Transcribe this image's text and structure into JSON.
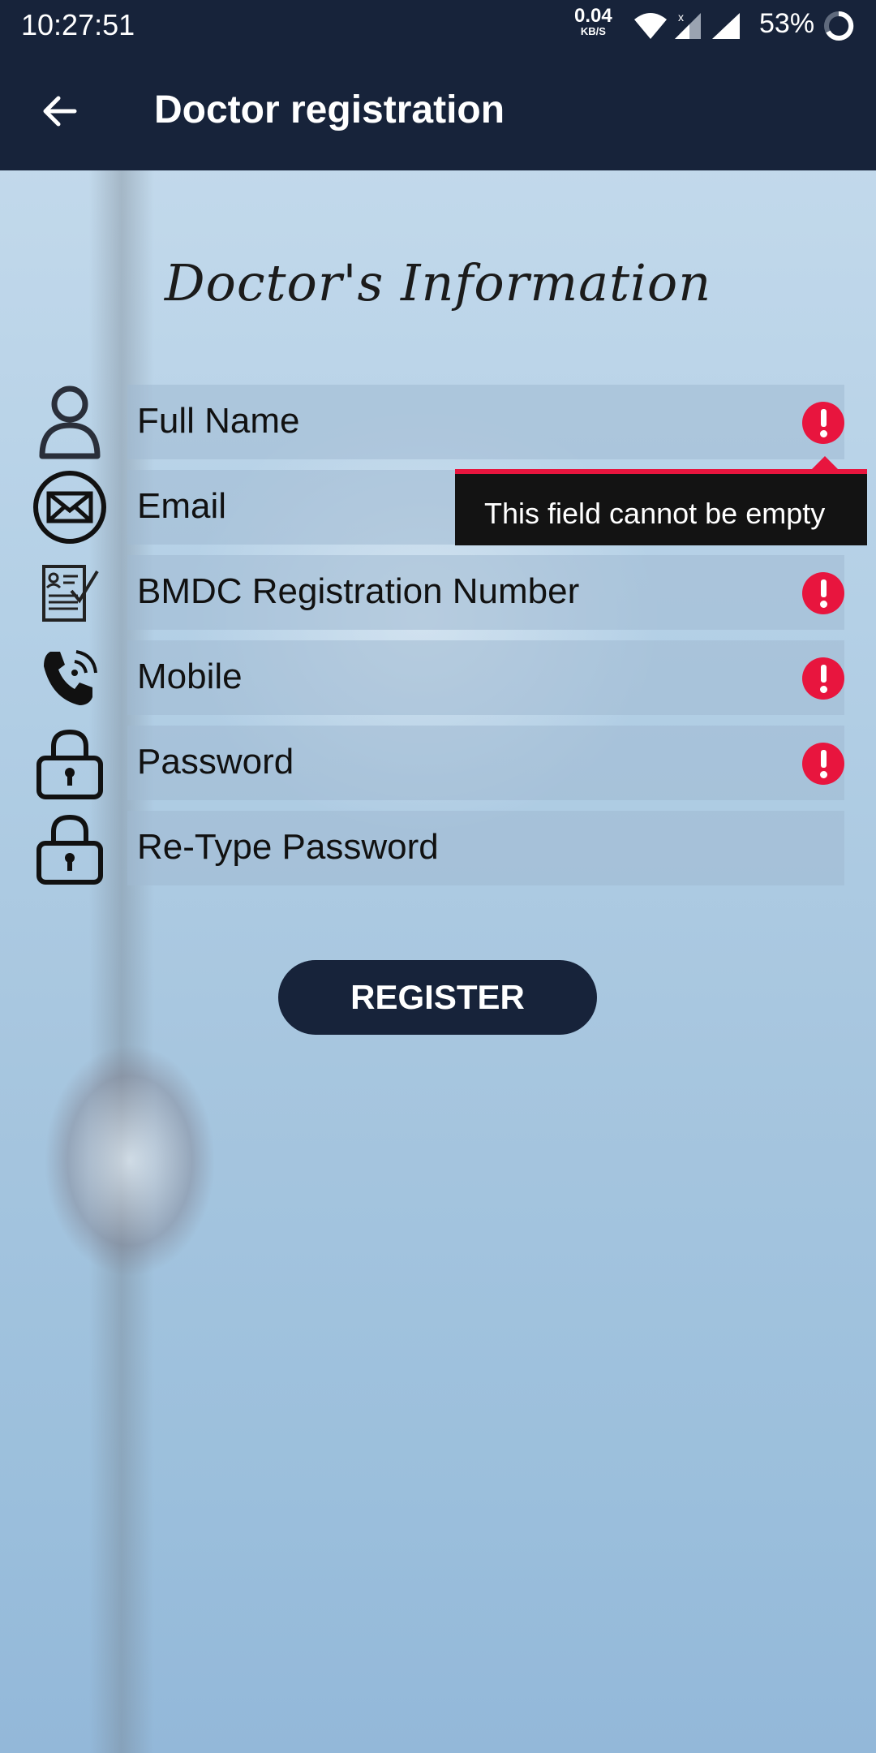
{
  "status_bar": {
    "time": "10:27:51",
    "net_speed_value": "0.04",
    "net_speed_unit": "KB/S",
    "battery": "53%"
  },
  "app_bar": {
    "title": "Doctor registration",
    "back_icon": "arrow-left-icon"
  },
  "form": {
    "section_title": "Doctor's Information",
    "fields": [
      {
        "label": "Full Name",
        "icon": "person-icon",
        "error": true
      },
      {
        "label": "Email",
        "icon": "envelope-icon",
        "error": true
      },
      {
        "label": "BMDC Registration Number",
        "icon": "document-check-icon",
        "error": true
      },
      {
        "label": "Mobile",
        "icon": "phone-icon",
        "error": true
      },
      {
        "label": "Password",
        "icon": "lock-icon",
        "error": true
      },
      {
        "label": "Re-Type Password",
        "icon": "lock-icon",
        "error": false
      }
    ],
    "tooltip": "This field cannot be empty",
    "register_label": "REGISTER"
  },
  "colors": {
    "bar_background": "#17233a",
    "error_red": "#e8153e",
    "tooltip_background": "#131313"
  }
}
